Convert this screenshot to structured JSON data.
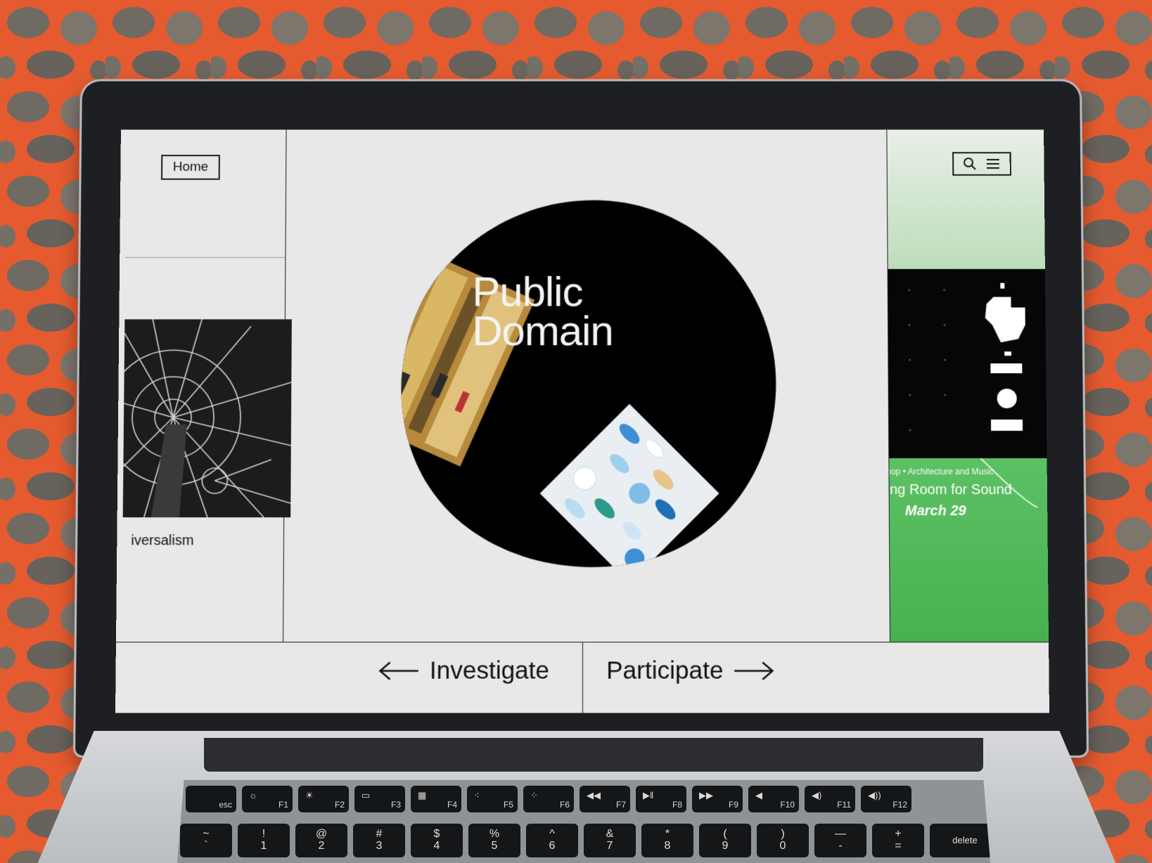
{
  "page": {
    "home_label": "Home",
    "left_caption": "iversalism",
    "hero_title": "Public\nDomain",
    "event": {
      "meta": "hop • Architecture and Music",
      "title": "ing Room for Sound",
      "date": "March 29"
    },
    "nav": {
      "prev_label": "Investigate",
      "next_label": "Participate"
    },
    "icons": [
      "search-icon",
      "menu-icon",
      "arrow-left-icon",
      "arrow-right-icon"
    ]
  },
  "keyboard": {
    "function_row": [
      "esc",
      "F1",
      "F2",
      "F3",
      "F4",
      "F5",
      "F6",
      "F7",
      "F8",
      "F9",
      "F10",
      "F11",
      "F12"
    ],
    "number_row": [
      {
        "top": "~",
        "bottom": "`"
      },
      {
        "top": "!",
        "bottom": "1"
      },
      {
        "top": "@",
        "bottom": "2"
      },
      {
        "top": "#",
        "bottom": "3"
      },
      {
        "top": "$",
        "bottom": "4"
      },
      {
        "top": "%",
        "bottom": "5"
      },
      {
        "top": "^",
        "bottom": "6"
      },
      {
        "top": "&",
        "bottom": "7"
      },
      {
        "top": "*",
        "bottom": "8"
      },
      {
        "top": "(",
        "bottom": "9"
      },
      {
        "top": ")",
        "bottom": "0"
      },
      {
        "top": "—",
        "bottom": "-"
      },
      {
        "top": "+",
        "bottom": "="
      }
    ],
    "delete_label": "delete"
  },
  "colors": {
    "fence_orange": "#e85a30",
    "screen_bg": "#e8e8e8",
    "event_green": "#4db554",
    "ink": "#111111"
  }
}
